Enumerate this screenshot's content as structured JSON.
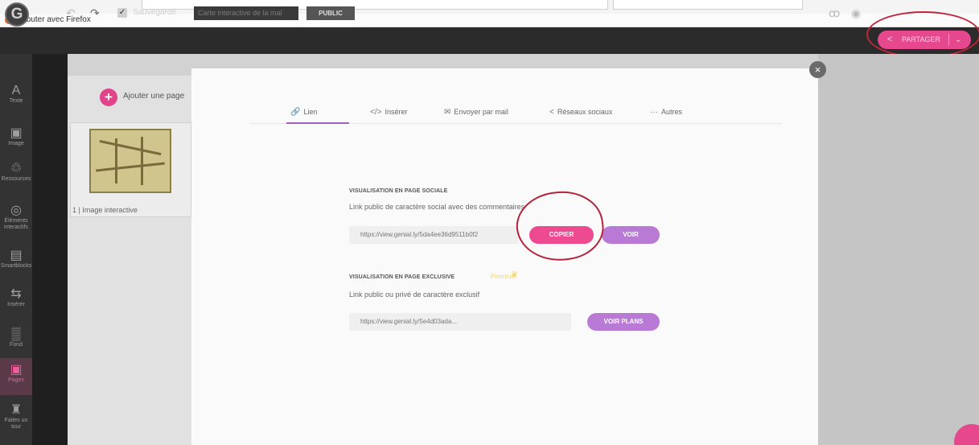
{
  "browser": {
    "tab_title": "Débuter avec Firefox"
  },
  "toolbar": {
    "saved_label": "Sauvegardé",
    "title_value": "Carte interactive de la mal",
    "public_label": "PUBLIC",
    "share_label": "PARTAGER",
    "logo_letter": "G"
  },
  "sidebar": {
    "items": [
      {
        "label": "Texte",
        "icon": "A"
      },
      {
        "label": "Image",
        "icon": "▣"
      },
      {
        "label": "Ressources",
        "icon": "♲"
      },
      {
        "label": "Éléments interactifs",
        "icon": "◎"
      },
      {
        "label": "Smartblocks",
        "icon": "▤"
      },
      {
        "label": "Insérer",
        "icon": "⇆"
      },
      {
        "label": "Fond",
        "icon": "▒"
      },
      {
        "label": "Pages",
        "icon": "▣"
      },
      {
        "label": "Faites un tour",
        "icon": "♜"
      }
    ]
  },
  "pages": {
    "add_label": "Ajouter une page",
    "items": [
      {
        "label": "1 | Image interactive"
      }
    ]
  },
  "share_modal": {
    "tabs": [
      {
        "label": "Lien",
        "icon": "🔗"
      },
      {
        "label": "Insérer",
        "icon": "</>"
      },
      {
        "label": "Envoyer par mail",
        "icon": "✉"
      },
      {
        "label": "Réseaux sociaux",
        "icon": "<"
      },
      {
        "label": "Autres",
        "icon": "···"
      }
    ],
    "social": {
      "title": "VISUALISATION EN PAGE SOCIALE",
      "description": "Link public de caractère social avec des commentaires",
      "url": "https://view.genial.ly/5da4ee36d9511b0f2",
      "copy_label": "COPIER",
      "view_label": "VOIR"
    },
    "exclusive": {
      "title": "VISUALISATION EN PAGE EXCLUSIVE",
      "premium_label": "Premium",
      "description": "Link public ou privé de caractère exclusif",
      "url": "https://view.genial.ly/5e4d03ada...",
      "plans_label": "VOIR PLANS"
    }
  },
  "colors": {
    "accent_pink": "#ee4a8f",
    "accent_purple": "#b97ad6",
    "annotation_red": "#c2243b"
  }
}
